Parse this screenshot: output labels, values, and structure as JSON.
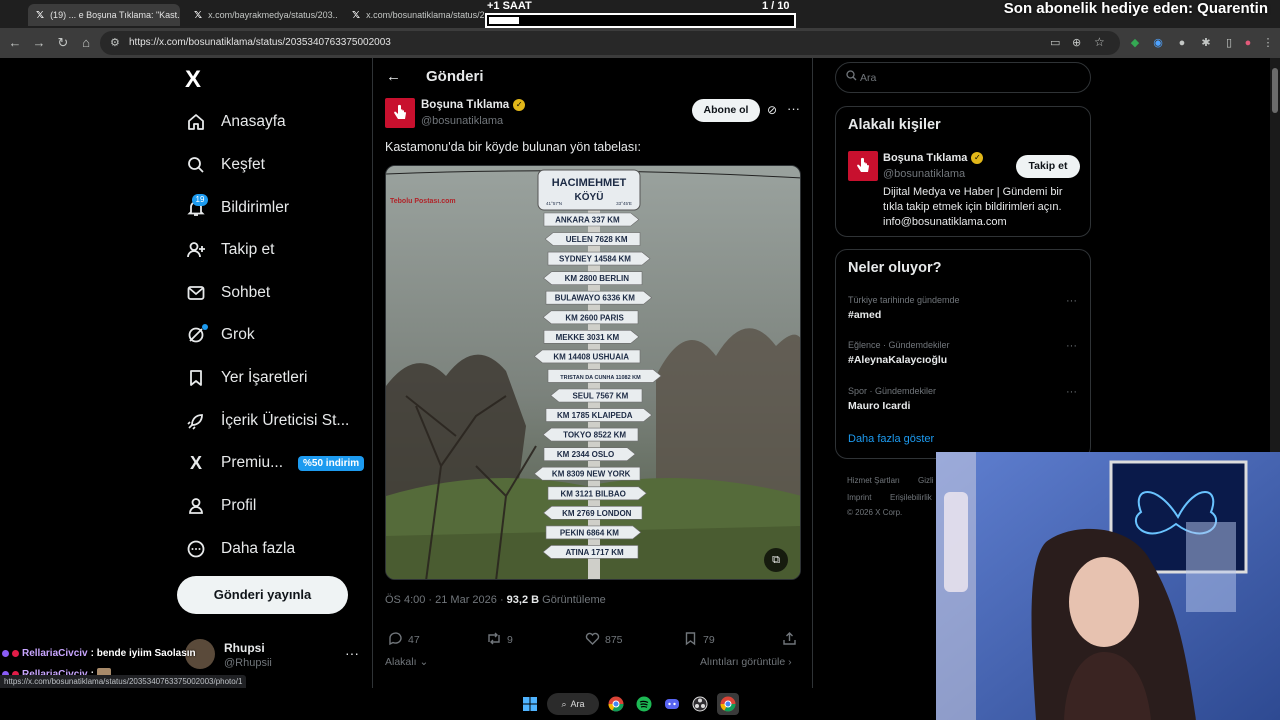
{
  "browser": {
    "tabs": [
      {
        "title": "(19) ... e Boşuna Tıklama: \"Kast...",
        "active": true
      },
      {
        "title": "x.com/bayrakmedya/status/203...",
        "active": false
      },
      {
        "title": "x.com/bosunatiklama/status/20...",
        "active": false
      }
    ],
    "url": "https://x.com/bosunatiklama/status/2035340763375002003",
    "status_url": "https://x.com/bosunatiklama/status/2035340763375002003/photo/1"
  },
  "overlay": {
    "timer_label": "+1 SAAT",
    "page_count": "1  / 10",
    "timer_progress": 0.1,
    "sub_banner": "Son abonelik hediye eden: Quarentin"
  },
  "nav": {
    "logo": "X",
    "items": [
      {
        "label": "Anasayfa",
        "icon": "home-icon"
      },
      {
        "label": "Keşfet",
        "icon": "search-icon"
      },
      {
        "label": "Bildirimler",
        "icon": "bell-icon"
      },
      {
        "label": "Takip et",
        "icon": "person-add-icon"
      },
      {
        "label": "Sohbet",
        "icon": "mail-icon"
      },
      {
        "label": "Grok",
        "icon": "grok-icon"
      },
      {
        "label": "Yer İşaretleri",
        "icon": "bookmark-icon"
      },
      {
        "label": "İçerik Üreticisi St...",
        "icon": "rocket-icon"
      },
      {
        "label": "Premiu...",
        "icon": "x-premium-icon"
      },
      {
        "label": "Profil",
        "icon": "person-icon"
      },
      {
        "label": "Daha fazla",
        "icon": "more-circle-icon"
      }
    ],
    "notif_count": "19",
    "premium_badge": "%50 indirim",
    "post_button": "Gönderi yayınla",
    "account": {
      "name": "Rhupsi",
      "handle": "@Rhupsii",
      "more": "···"
    }
  },
  "main": {
    "title": "Gönderi",
    "author": {
      "name": "Boşuna Tıklama",
      "handle": "@bosunatiklama"
    },
    "subscribe": "Abone ol",
    "more": "···",
    "text": "Kastamonu'da bir köyde bulunan yön tabelası:",
    "time": "ÖS 4:00 · 21 Mar 2026 · ",
    "views_count": "93,2 B",
    "views_label": "Görüntüleme",
    "actions": {
      "replies": "47",
      "reposts": "9",
      "likes": "875",
      "bookmarks": "79"
    },
    "relevant": "Alakalı",
    "quotes": "Alıntıları görüntüle",
    "media": {
      "signs": [
        "HACIMEHMET KÖYÜ",
        "ANKARA 337 KM",
        "UELEN 7628 KM",
        "SYDNEY 14584 KM",
        "KM 2800 BERLIN",
        "BULAWAYO 6336 KM",
        "KM 2600 PARIS",
        "MEKKE 3031 KM",
        "KM 14408 USHUAIA",
        "TRISTAN DA CUNHA 11082 KM",
        "SEUL 7567 KM",
        "KM 1785 KLAIPEDA",
        "TOKYO 8522 KM",
        "KM 2344 OSLO",
        "KM 8309 NEW YORK",
        "KM 3121 BILBAO",
        "KM 2769 LONDON",
        "PEKIN 6864 KM",
        "ATINA 1717 KM"
      ],
      "coord_left": "41°57'N",
      "coord_right": "33°45'E",
      "watermark": "Tebolu Postası.com"
    }
  },
  "sidebar": {
    "search_placeholder": "Ara",
    "related_title": "Alakalı kişiler",
    "related": {
      "name": "Boşuna Tıklama",
      "handle": "@bosunatiklama",
      "follow": "Takip et",
      "bio": "Dijital Medya ve Haber | Gündemi bir tıkla takip etmek için bildirimleri açın. info@bosunatiklama.com"
    },
    "trends_title": "Neler oluyor?",
    "trends": [
      {
        "meta": "Türkiye tarihinde gündemde",
        "name": "#amed"
      },
      {
        "meta": "Eğlence · Gündemdekiler",
        "name": "#AleynaKalaycıoğlu"
      },
      {
        "meta": "Spor · Gündemdekiler",
        "name": "Mauro Icardi"
      }
    ],
    "show_more": "Daha fazla göster",
    "footer": [
      "Hizmet Şartları",
      "Gizli",
      "Imprint",
      "Erişilebilirlik",
      "© 2026 X Corp."
    ]
  },
  "chat": [
    {
      "user": "RellariaCivciv",
      "message": ": bende iyiim Saolasın"
    },
    {
      "user": "RellariaCivciv",
      "message": ":"
    }
  ],
  "taskbar": {
    "search": "Ara"
  }
}
